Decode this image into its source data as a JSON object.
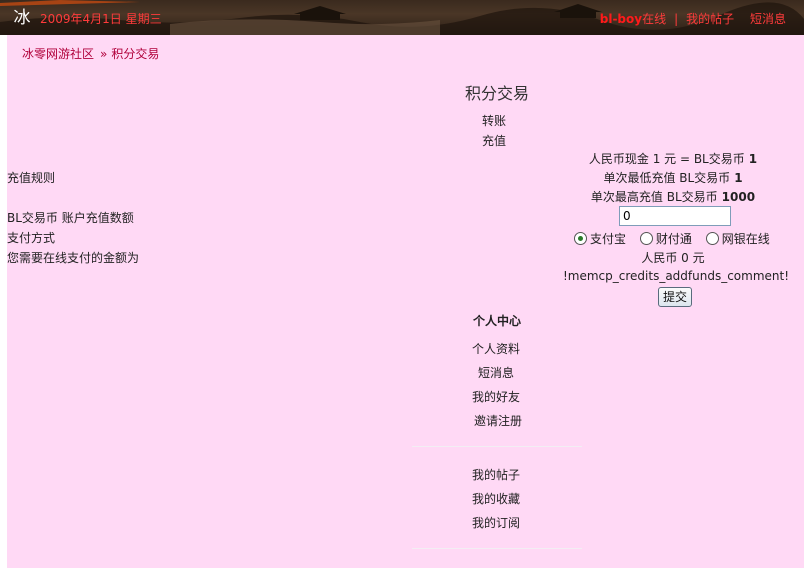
{
  "header": {
    "logo_char": "冰",
    "date": "2009年4月1日  星期三",
    "username": "bl-boy",
    "online": "在线",
    "separator": "|",
    "my_posts": "我的帖子",
    "messages": "短消息"
  },
  "breadcrumb": {
    "home": "冰零网游社区",
    "arrow": "»",
    "current": "积分交易"
  },
  "page_title": "积分交易",
  "tabs": {
    "transfer": "转账",
    "recharge": "充值"
  },
  "left_labels": {
    "rules": "充值规则",
    "amount": "BL交易币  账户充值数额",
    "payment": "支付方式",
    "total": "您需要在线支付的金额为"
  },
  "rules": {
    "rate": "人民币现金  1 元  = BL交易币",
    "rate_value": "1",
    "min_label": "单次最低充值  BL交易币",
    "min_value": "1",
    "max_label": "单次最高充值  BL交易币",
    "max_value": "1000"
  },
  "amount_input": {
    "value": "0"
  },
  "payment_options": {
    "alipay": "支付宝",
    "tenpay": "财付通",
    "chinabank": "网银在线",
    "selected": "alipay"
  },
  "total": "人民币  0 元",
  "comment": "!memcp_credits_addfunds_comment!",
  "submit_label": "提交",
  "personal_center": {
    "title": "个人中心",
    "profile": "个人资料",
    "pm": "短消息",
    "friends": "我的好友",
    "invite": "邀请注册",
    "my_threads": "我的帖子",
    "favorites": "我的收藏",
    "subscriptions": "我的订阅"
  }
}
